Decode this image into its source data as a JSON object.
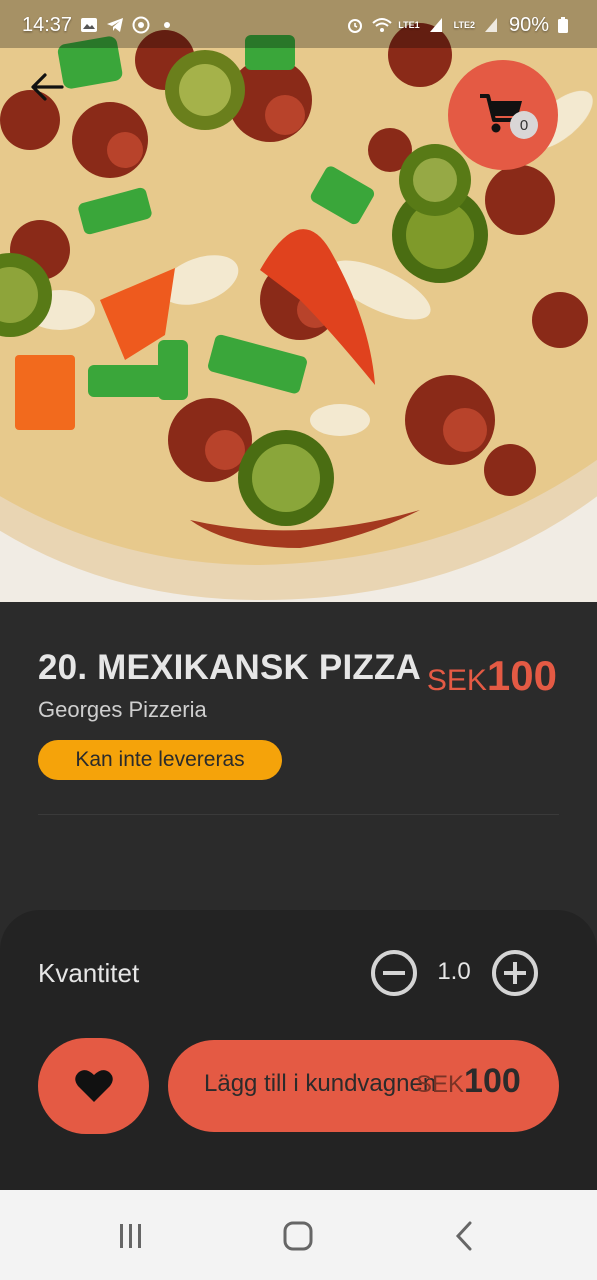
{
  "status_bar": {
    "time": "14:37",
    "battery": "90%",
    "sim1": "LTE1",
    "sim2": "LTE2"
  },
  "header": {
    "back_icon": "arrow-left-icon",
    "cart_icon": "cart-icon",
    "cart_count": "0"
  },
  "product": {
    "title": "20. MEXIKANSK PIZZA",
    "currency": "SEK",
    "price": "100",
    "restaurant": "Georges Pizzeria",
    "delivery_badge": "Kan inte levereras"
  },
  "order": {
    "quantity_label": "Kvantitet",
    "quantity": "1.0",
    "add_to_cart_label": "Lägg till i kundvagnen",
    "currency": "SEK",
    "total": "100"
  },
  "colors": {
    "accent": "#e45a44",
    "badge": "#f5a30a",
    "background": "#2b2b2b",
    "sheet": "#232323"
  }
}
